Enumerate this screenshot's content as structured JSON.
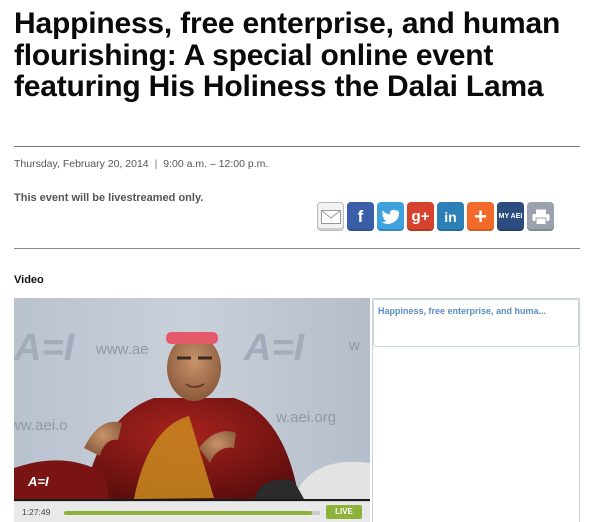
{
  "article": {
    "title": "Happiness, free enterprise, and human flourishing: A special online event featuring His Holiness the Dalai Lama",
    "date": "Thursday, February 20, 2014",
    "separator": "|",
    "time": "9:00 a.m. – 12:00 p.m.",
    "livestream_note": "This event will be livestreamed only."
  },
  "share_bar": {
    "buttons": [
      {
        "name": "email-share-button",
        "icon": "envelope-icon",
        "glyph": ""
      },
      {
        "name": "facebook-share-button",
        "icon": "facebook-icon",
        "glyph": "f"
      },
      {
        "name": "twitter-share-button",
        "icon": "twitter-bird-icon",
        "glyph": ""
      },
      {
        "name": "google-plus-share-button",
        "icon": "google-plus-icon",
        "glyph": "g+"
      },
      {
        "name": "linkedin-share-button",
        "icon": "linkedin-icon",
        "glyph": "in"
      },
      {
        "name": "more-share-button",
        "icon": "plus-icon",
        "glyph": "+"
      },
      {
        "name": "my-aei-button",
        "icon": "my-aei-icon",
        "glyph": "MY AEI"
      },
      {
        "name": "print-button",
        "icon": "printer-icon",
        "glyph": ""
      }
    ]
  },
  "video_section": {
    "label": "Video",
    "watermark_url": "www.aei.org",
    "logo_text": "AEI",
    "timecode": "1:27:49",
    "progress": 0.97,
    "live_label": "LIVE"
  },
  "playlist": {
    "items": [
      {
        "title": "Happiness, free enterprise, and huma..."
      }
    ]
  },
  "colors": {
    "title": "#0a0a0a",
    "meta": "#555555",
    "live_green": "#8fb23a",
    "playlist_link": "#5a8ec4",
    "facebook": "#3b5ea8",
    "twitter": "#3fa2df",
    "gplus": "#d7422e",
    "linkedin": "#2d7fb8",
    "more": "#f26b2a",
    "myaei": "#2c4b7f",
    "print": "#9aa3ad"
  }
}
